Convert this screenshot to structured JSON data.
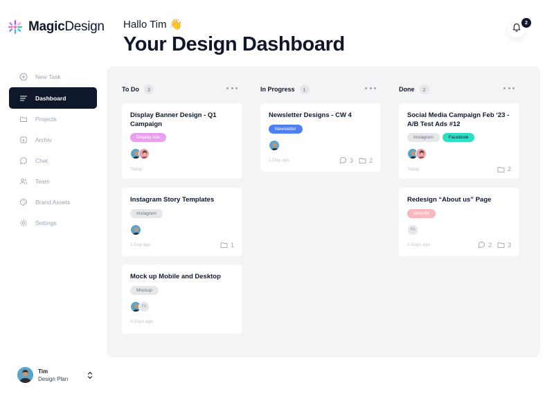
{
  "app": {
    "brand_bold": "Magic",
    "brand_light": "Design"
  },
  "sidebar": {
    "items": [
      {
        "label": "New Task",
        "icon": "plus-circle-icon",
        "active": false
      },
      {
        "label": "Dashboard",
        "icon": "menu-lines-icon",
        "active": true
      },
      {
        "label": "Projects",
        "icon": "folder-icon",
        "active": false
      },
      {
        "label": "Archiv",
        "icon": "archive-box-icon",
        "active": false
      },
      {
        "label": "Chat",
        "icon": "chat-bubble-icon",
        "active": false
      },
      {
        "label": "Team",
        "icon": "team-icon",
        "active": false
      },
      {
        "label": "Brand Assets",
        "icon": "palette-icon",
        "active": false
      },
      {
        "label": "Settings",
        "icon": "gear-icon",
        "active": false
      }
    ],
    "user": {
      "name": "Tim",
      "plan": "Design Plan"
    }
  },
  "header": {
    "greeting": "Hallo Tim 👋",
    "title": "Your Design Dashboard",
    "notifications": "2"
  },
  "colors": {
    "dark": "#0f172a",
    "board_bg": "#f3f4f6",
    "tag_display_ads": "#e9a0ec",
    "tag_newsletter": "#4f7ff0",
    "tag_facebook": "#2de0c5",
    "tag_website": "#f7b7c0",
    "tag_gray": "#e5e7eb"
  },
  "columns": [
    {
      "title": "To Do",
      "count": "3",
      "cards": [
        {
          "title": "Display Banner Design - Q1 Campaign",
          "tags": [
            "Display Ads"
          ],
          "date": "Today"
        },
        {
          "title": "Instagram Story Templates",
          "tags": [
            "Instagram"
          ],
          "date": "1 Day ago",
          "files": "1"
        },
        {
          "title": "Mock up Mobile and Desktop",
          "tags": [
            "Mockup"
          ],
          "date": "3 Days ago",
          "initials": "FA"
        }
      ]
    },
    {
      "title": "In Progress",
      "count": "1",
      "cards": [
        {
          "title": "Newsletter Designs - CW 4",
          "tags": [
            "Newsletter"
          ],
          "date": "1 Day ago",
          "comments": "3",
          "files": "2"
        }
      ]
    },
    {
      "title": "Done",
      "count": "2",
      "cards": [
        {
          "title": "Social Media Campaign Feb ‘23 - A/B Test Ads #12",
          "tags": [
            "Instagram",
            "Facebook"
          ],
          "date": "Today",
          "files": "2"
        },
        {
          "title": "Redesign “About us” Page",
          "tags": [
            "Website"
          ],
          "date": "3 Days ago",
          "initials": "FA",
          "comments": "2",
          "files": "3"
        }
      ]
    }
  ]
}
